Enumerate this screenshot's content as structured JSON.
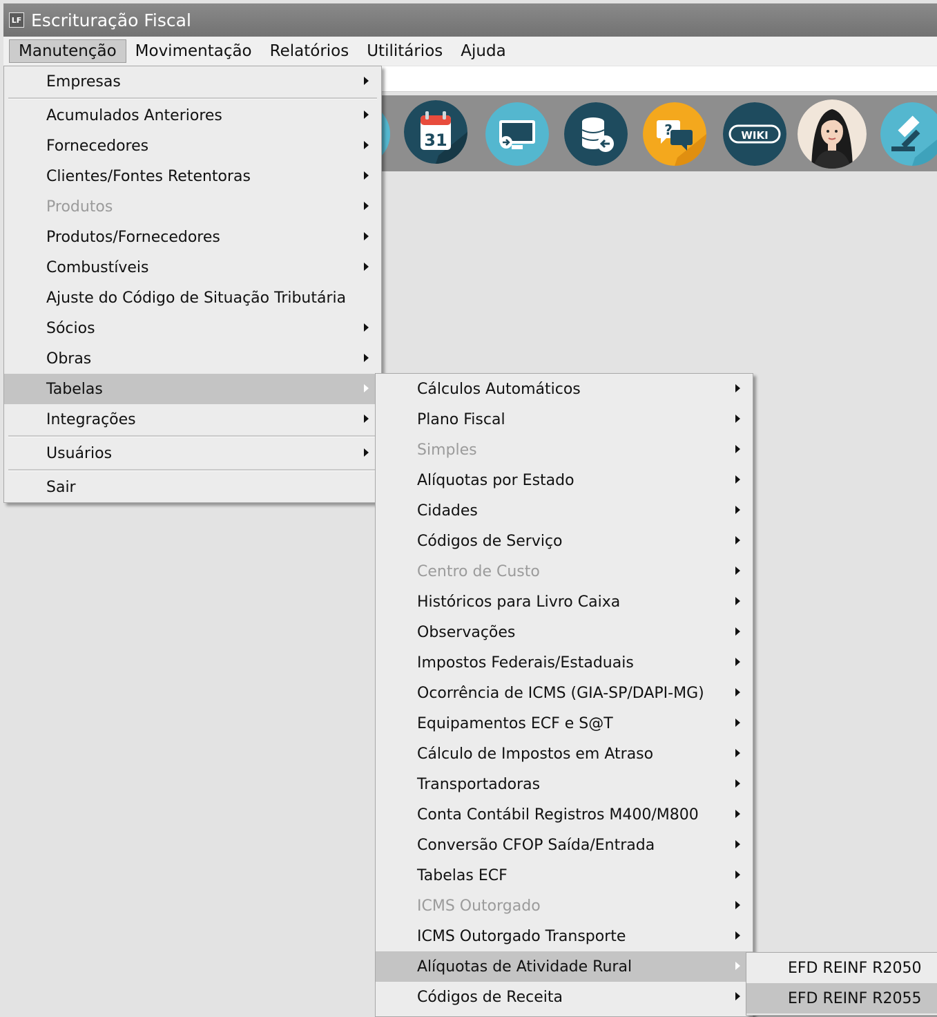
{
  "window": {
    "title": "Escrituração Fiscal",
    "icon_label": "LF"
  },
  "menubar": {
    "items": [
      {
        "label": "Manutenção"
      },
      {
        "label": "Movimentação"
      },
      {
        "label": "Relatórios"
      },
      {
        "label": "Utilitários"
      },
      {
        "label": "Ajuda"
      }
    ]
  },
  "toolbar": {
    "icons": [
      {
        "name": "calendar-icon",
        "text": "31",
        "color": "#1e4b5e"
      },
      {
        "name": "monitor-icon",
        "color": "#54b7cf"
      },
      {
        "name": "database-icon",
        "color": "#1e4b5e"
      },
      {
        "name": "help-chat-icon",
        "text": "?",
        "color": "#f4a81d"
      },
      {
        "name": "wiki-icon",
        "text": "WIKI",
        "color": "#1e4b5e"
      },
      {
        "name": "avatar-icon",
        "color": "#f1e6da"
      },
      {
        "name": "gavel-icon",
        "color": "#54b7cf"
      }
    ]
  },
  "menu_manutencao": {
    "items": [
      {
        "label": "Empresas",
        "submenu": true
      },
      {
        "label": "Acumulados Anteriores",
        "submenu": true
      },
      {
        "label": "Fornecedores",
        "submenu": true
      },
      {
        "label": "Clientes/Fontes Retentoras",
        "submenu": true
      },
      {
        "label": "Produtos",
        "submenu": true,
        "disabled": true
      },
      {
        "label": "Produtos/Fornecedores",
        "submenu": true
      },
      {
        "label": "Combustíveis",
        "submenu": true
      },
      {
        "label": "Ajuste do Código de Situação Tributária",
        "submenu": false
      },
      {
        "label": "Sócios",
        "submenu": true
      },
      {
        "label": "Obras",
        "submenu": true
      },
      {
        "label": "Tabelas",
        "submenu": true,
        "highlighted": true
      },
      {
        "label": "Integrações",
        "submenu": true
      },
      {
        "label": "Usuários",
        "submenu": true
      },
      {
        "label": "Sair",
        "submenu": false
      }
    ]
  },
  "menu_tabelas": {
    "items": [
      {
        "label": "Cálculos Automáticos",
        "submenu": true
      },
      {
        "label": "Plano Fiscal",
        "submenu": true
      },
      {
        "label": "Simples",
        "submenu": true,
        "disabled": true
      },
      {
        "label": "Alíquotas por Estado",
        "submenu": true
      },
      {
        "label": "Cidades",
        "submenu": true
      },
      {
        "label": "Códigos de Serviço",
        "submenu": true
      },
      {
        "label": "Centro de Custo",
        "submenu": true,
        "disabled": true
      },
      {
        "label": "Históricos para Livro Caixa",
        "submenu": true
      },
      {
        "label": "Observações",
        "submenu": true
      },
      {
        "label": "Impostos Federais/Estaduais",
        "submenu": true
      },
      {
        "label": "Ocorrência de ICMS (GIA-SP/DAPI-MG)",
        "submenu": true
      },
      {
        "label": "Equipamentos ECF e S@T",
        "submenu": true
      },
      {
        "label": "Cálculo de Impostos em Atraso",
        "submenu": true
      },
      {
        "label": "Transportadoras",
        "submenu": true
      },
      {
        "label": "Conta Contábil Registros M400/M800",
        "submenu": true
      },
      {
        "label": "Conversão CFOP Saída/Entrada",
        "submenu": true
      },
      {
        "label": "Tabelas ECF",
        "submenu": true
      },
      {
        "label": "ICMS Outorgado",
        "submenu": true,
        "disabled": true
      },
      {
        "label": "ICMS Outorgado Transporte",
        "submenu": true
      },
      {
        "label": "Alíquotas de Atividade Rural",
        "submenu": true,
        "highlighted": true
      },
      {
        "label": "Códigos de Receita",
        "submenu": true
      }
    ]
  },
  "menu_rural": {
    "items": [
      {
        "label": "EFD REINF R2050"
      },
      {
        "label": "EFD REINF R2055",
        "highlighted": true
      }
    ]
  }
}
